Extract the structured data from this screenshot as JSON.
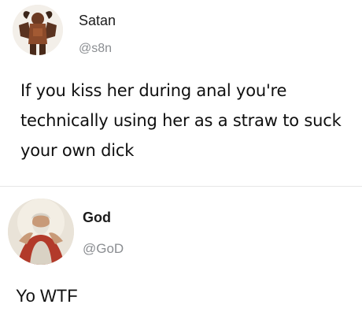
{
  "tweets": [
    {
      "author": "Satan",
      "handle": "@s8n",
      "text": "If you kiss her during anal you're technically using her as a straw to suck your own dick",
      "avatar_icon": "demon-figure-avatar"
    },
    {
      "author": "God",
      "handle": "@GoD",
      "text": "Yo WTF",
      "avatar_icon": "bearded-god-avatar"
    }
  ],
  "colors": {
    "background": "#ffffff",
    "handle": "#8a8d91",
    "divider": "#e6e6e6"
  }
}
